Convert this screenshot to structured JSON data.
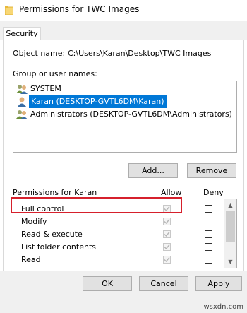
{
  "window": {
    "title": "Permissions for TWC Images",
    "folder_icon": "folder-icon"
  },
  "tabs": [
    {
      "label": "Security",
      "active": true
    }
  ],
  "object": {
    "label": "Object name:",
    "value": "C:\\Users\\Karan\\Desktop\\TWC Images"
  },
  "group": {
    "label": "Group or user names:",
    "items": [
      {
        "name": "SYSTEM",
        "icon": "users-icon",
        "selected": false
      },
      {
        "name": "Karan (DESKTOP-GVTL6DM\\Karan)",
        "icon": "user-icon",
        "selected": true
      },
      {
        "name": "Administrators (DESKTOP-GVTL6DM\\Administrators)",
        "icon": "users-icon",
        "selected": false
      }
    ]
  },
  "buttons": {
    "add": "Add...",
    "remove": "Remove",
    "ok": "OK",
    "cancel": "Cancel",
    "apply": "Apply"
  },
  "permissions": {
    "label": "Permissions for Karan",
    "allow_header": "Allow",
    "deny_header": "Deny",
    "rows": [
      {
        "name": "Full control",
        "allow": true,
        "deny": false
      },
      {
        "name": "Modify",
        "allow": true,
        "deny": false
      },
      {
        "name": "Read & execute",
        "allow": true,
        "deny": false
      },
      {
        "name": "List folder contents",
        "allow": true,
        "deny": false
      },
      {
        "name": "Read",
        "allow": true,
        "deny": false
      }
    ]
  },
  "watermark": "wsxdn.com",
  "colors": {
    "selection": "#0078d7",
    "highlight_box": "#d6202c",
    "dialog_bg": "#f0f0f0"
  }
}
